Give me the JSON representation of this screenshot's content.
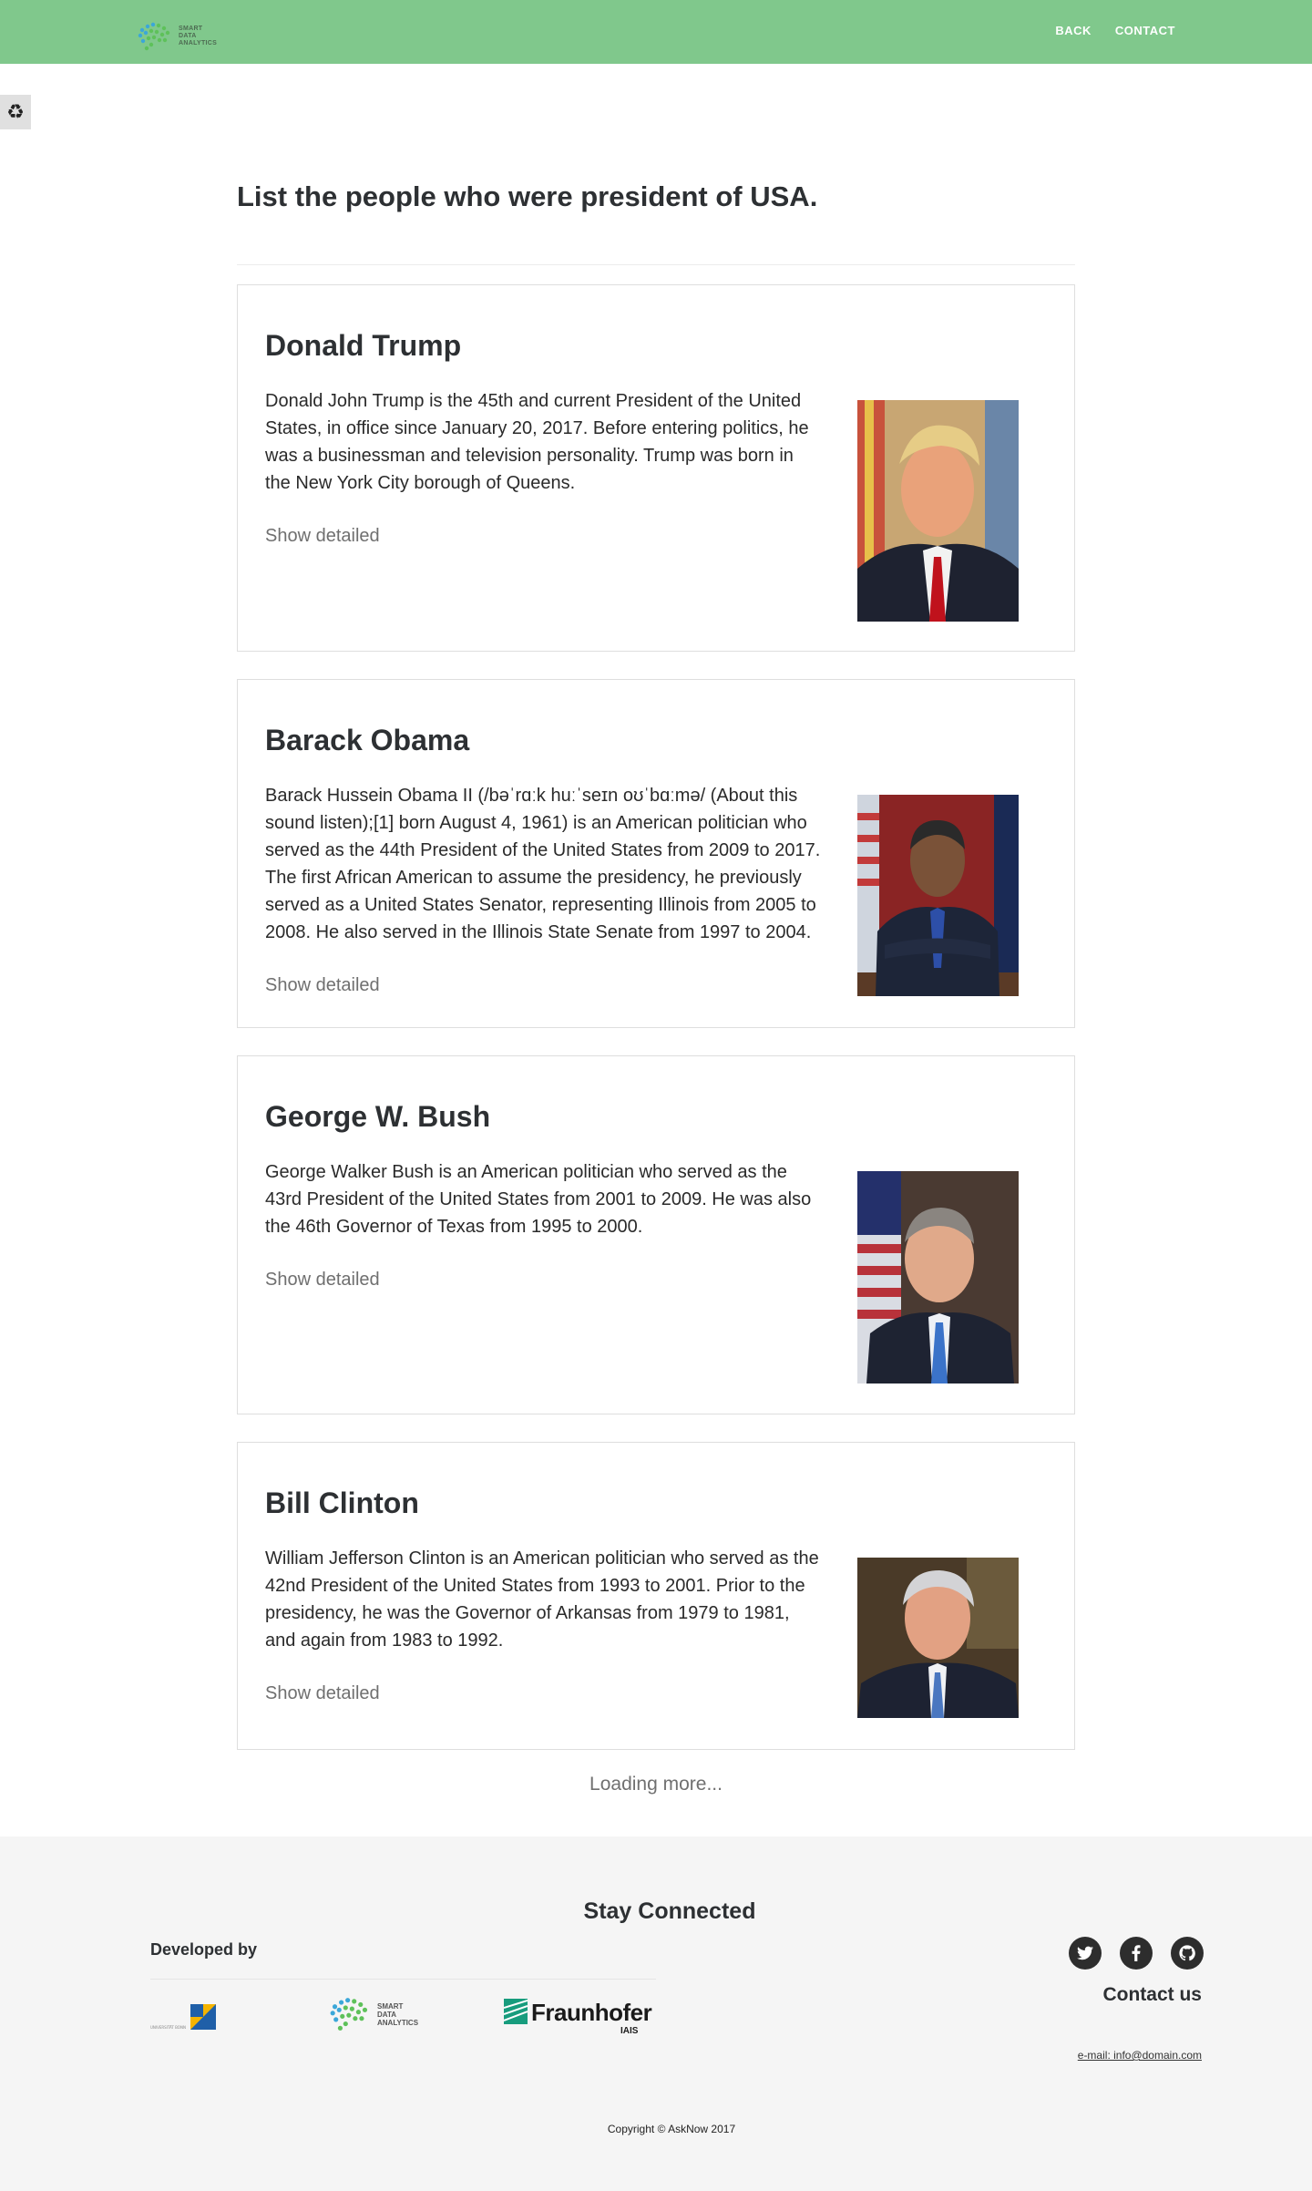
{
  "header": {
    "logo_lines": [
      "Smart",
      "Data",
      "Analytics"
    ],
    "nav": [
      {
        "label": "BACK"
      },
      {
        "label": "CONTACT"
      }
    ],
    "brand_color": "#80c88c"
  },
  "side_widget": {
    "glyph": "♻"
  },
  "main": {
    "question": "List the people who were president of USA.",
    "results": [
      {
        "name": "Donald Trump",
        "bio": "Donald John Trump is the 45th and current President of the United States, in office since January 20, 2017. Before entering politics, he was a businessman and television personality. Trump was born in the New York City borough of Queens.",
        "detail_label": "Show detailed"
      },
      {
        "name": "Barack Obama",
        "bio": "Barack Hussein Obama II (/bəˈrɑːk huːˈseɪn oʊˈbɑːmə/ (About this sound listen);[1] born August 4, 1961) is an American politician who served as the 44th President of the United States from 2009 to 2017. The first African American to assume the presidency, he previously served as a United States Senator, representing Illinois from 2005 to 2008. He also served in the Illinois State Senate from 1997 to 2004.",
        "detail_label": "Show detailed"
      },
      {
        "name": "George W. Bush",
        "bio": "George Walker Bush is an American politician who served as the 43rd President of the United States from 2001 to 2009. He was also the 46th Governor of Texas from 1995 to 2000.",
        "detail_label": "Show detailed"
      },
      {
        "name": "Bill Clinton",
        "bio": "William Jefferson Clinton is an American politician who served as the 42nd President of the United States from 1993 to 2001. Prior to the presidency, he was the Governor of Arkansas from 1979 to 1981, and again from 1983 to 1992.",
        "detail_label": "Show detailed"
      }
    ],
    "loading_text": "Loading more..."
  },
  "footer": {
    "stay_connected": "Stay Connected",
    "developed_by": "Developed by",
    "partners": {
      "university_text": "UNIVERSITÄT BONN",
      "sda_lines": [
        "Smart",
        "Data",
        "Analytics"
      ],
      "fraunhofer": "Fraunhofer",
      "fraunhofer_sub": "IAIS"
    },
    "social_icons": [
      "twitter-icon",
      "facebook-icon",
      "github-icon"
    ],
    "contact_us": "Contact us",
    "email": "e-mail: info@domain.com",
    "copyright": "Copyright © AskNow 2017"
  }
}
